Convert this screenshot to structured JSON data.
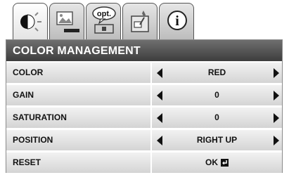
{
  "tabs": [
    {
      "icon": "picture-adjust-icon",
      "active": true
    },
    {
      "icon": "image-screen-icon",
      "active": false
    },
    {
      "icon": "options-icon",
      "label": "opt.",
      "active": false
    },
    {
      "icon": "setup-icon",
      "active": false
    },
    {
      "icon": "info-icon",
      "active": false
    }
  ],
  "menu": {
    "title": "COLOR MANAGEMENT",
    "rows": [
      {
        "label": "COLOR",
        "value": "RED"
      },
      {
        "label": "GAIN",
        "value": "0"
      },
      {
        "label": "SATURATION",
        "value": "0"
      },
      {
        "label": "POSITION",
        "value": "RIGHT UP"
      },
      {
        "label": "RESET",
        "value": "OK"
      }
    ]
  }
}
